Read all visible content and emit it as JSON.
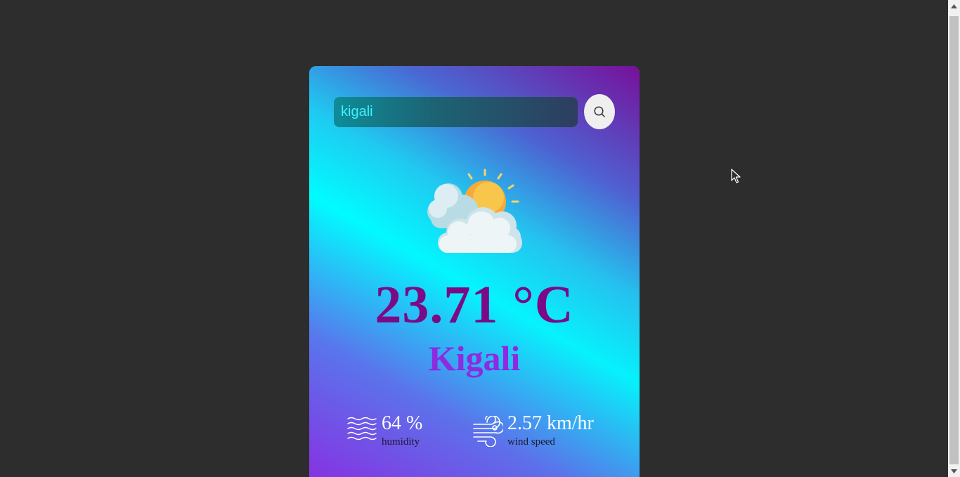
{
  "search": {
    "value": "kigali",
    "icon": "search-icon"
  },
  "weather": {
    "icon": "partly-cloudy-icon",
    "temperature": "23.71 °C",
    "city": "Kigali"
  },
  "details": {
    "humidity": {
      "value": "64 %",
      "label": "humidity",
      "icon": "humidity-icon"
    },
    "wind": {
      "value": "2.57 km/hr",
      "label": "wind speed",
      "icon": "wind-icon"
    }
  },
  "colors": {
    "background": "#2d2d2d",
    "temperature": "#7a0a86",
    "city": "#8e2ae0",
    "search_text": "#3ff2ff"
  }
}
